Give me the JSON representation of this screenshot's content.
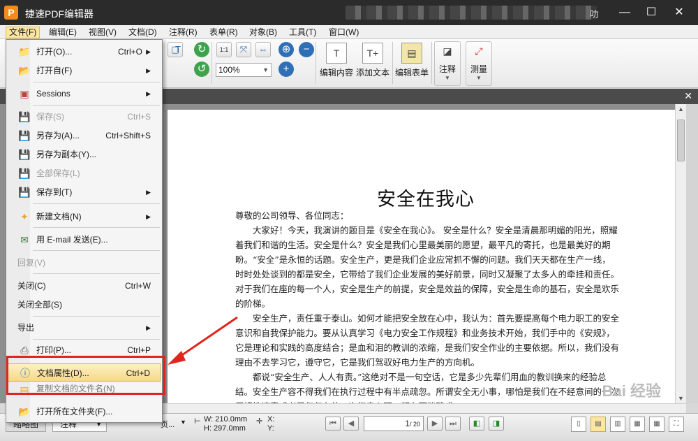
{
  "titlebar": {
    "app_icon_letter": "P",
    "title": "捷速PDF编辑器",
    "blur_tail": "叻",
    "minimize": "—",
    "maximize": "☐",
    "close": "✕"
  },
  "menubar": {
    "items": [
      "文件(F)",
      "编辑(E)",
      "视图(V)",
      "文档(D)",
      "注释(R)",
      "表单(R)",
      "对象(B)",
      "工具(T)",
      "窗口(W)"
    ]
  },
  "toolbar": {
    "zoom_value": "100%",
    "zoom_actual_label": "1:1",
    "buttons": [
      "编辑内容",
      "添加文本",
      "编辑表单",
      "注释",
      "测量"
    ]
  },
  "file_menu": {
    "items": [
      {
        "label": "打开(O)...",
        "shortcut": "Ctrl+O",
        "submenu": true,
        "icon": "folder-icon"
      },
      {
        "label": "打开自(F)",
        "shortcut": "",
        "submenu": true,
        "icon": "folder-open-icon"
      },
      {
        "label": "Sessions",
        "shortcut": "",
        "submenu": true,
        "icon": "sessions-icon"
      },
      {
        "label": "保存(S)",
        "shortcut": "Ctrl+S",
        "submenu": false,
        "icon": "save-icon",
        "disabled": true
      },
      {
        "label": "另存为(A)...",
        "shortcut": "Ctrl+Shift+S",
        "submenu": false,
        "icon": "save-as-icon"
      },
      {
        "label": "另存为副本(Y)...",
        "shortcut": "",
        "submenu": false,
        "icon": "save-copy-icon"
      },
      {
        "label": "全部保存(L)",
        "shortcut": "",
        "submenu": false,
        "icon": "save-all-icon",
        "disabled": true
      },
      {
        "label": "保存到(T)",
        "shortcut": "",
        "submenu": true,
        "icon": "save-to-icon"
      },
      {
        "label": "新建文档(N)",
        "shortcut": "",
        "submenu": true,
        "icon": "new-doc-icon"
      },
      {
        "label": "用 E-mail 发送(E)...",
        "shortcut": "",
        "submenu": false,
        "icon": "email-icon"
      },
      {
        "label": "回复(V)",
        "shortcut": "",
        "submenu": false,
        "disabled": true
      },
      {
        "label": "关闭(C)",
        "shortcut": "Ctrl+W",
        "submenu": false
      },
      {
        "label": "关闭全部(S)",
        "shortcut": "",
        "submenu": false
      },
      {
        "label": "导出",
        "shortcut": "",
        "submenu": true
      },
      {
        "label": "打印(P)...",
        "shortcut": "Ctrl+P",
        "submenu": false,
        "icon": "print-icon"
      },
      {
        "label": "文档属性(D)...",
        "shortcut": "Ctrl+D",
        "submenu": false,
        "icon": "info-icon",
        "highlighted": true
      },
      {
        "label": "复制文档的文件名(N)",
        "shortcut": "",
        "submenu": false,
        "icon": "copy-icon"
      },
      {
        "label": "打开所在文件夹(F)...",
        "shortcut": "",
        "submenu": false,
        "icon": "folder-icon"
      }
    ]
  },
  "document": {
    "title": "安全在我心",
    "paragraphs": [
      "尊敬的公司领导、各位同志：",
      "大家好！今天，我演讲的题目是《安全在我心》。 安全是什么？安全是清晨那明媚的阳光，照耀着我们和谐的生活。安全是什么？安全是我们心里最美丽的愿望，最平凡的寄托，也是最美好的期盼。“安全”是永恒的话题。安全生产，更是我们企业应常抓不懈的问题。我们天天都在生产一线，时时处处谈到的都是安全，它带给了我们企业发展的美好前景，同时又凝聚了太多人的牵挂和责任。对于我们在座的每一个人，安全是生产的前提，安全是效益的保障，安全是生命的基石，安全是欢乐的阶梯。",
      "安全生产，责任重于泰山。如何才能把安全放在心中，我认为：首先要提高每个电力职工的安全意识和自我保护能力。要从认真学习《电力安全工作规程》和业务技术开始，我们手中的《安规》，它是理论和实践的高度结合；是血和泪的教训的浓缩，是我们安全作业的主要依据。所以，我们没有理由不去学习它，遵守它，它是我们驾驭好电力生产的方向机。",
      "都说“安全生产、人人有责。”这绝对不是一句空话，它是多少先辈们用血的教训换来的经验总结。安全生产容不得我们在执行过程中有半点疏忽。所谓安全无小事，哪怕是我们在不经意间的一次习惯性违章或者是仅仅有的一次侥幸心理，都有可能酿成"
    ],
    "watermark": "Bai 经验"
  },
  "statusbar": {
    "tab_thumbnails": "缩略图",
    "tab_annotations": "注释",
    "page_label_fragment": "页...",
    "width": "W: 210.0mm",
    "height": "H: 297.0mm",
    "coord_x": "X:",
    "coord_y": "Y:",
    "page_current": "1",
    "page_total": "/ 20"
  },
  "colors": {
    "title_bar": "#2b2b2b",
    "highlight_border": "#e0251c",
    "menu_highlight": "#f6d98a",
    "app_icon": "#f28b1e"
  }
}
